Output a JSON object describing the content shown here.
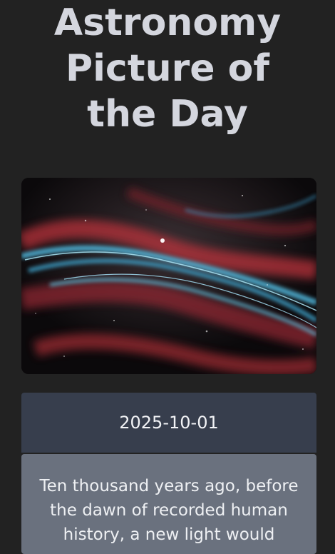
{
  "page": {
    "title_lines": [
      "Astronomy",
      "Picture of",
      "the Day"
    ]
  },
  "apod": {
    "image_alt": "Veil Nebula",
    "date": "2025-10-01",
    "explanation": "Ten thousand years ago, before the dawn of recorded human history, a new light would"
  },
  "colors": {
    "background": "#222222",
    "title": "#d4d6de",
    "date_card": "#373e4d",
    "description_card": "#6a717e",
    "nebula_red": "#b8323a",
    "nebula_cyan": "#4fb2d6"
  }
}
